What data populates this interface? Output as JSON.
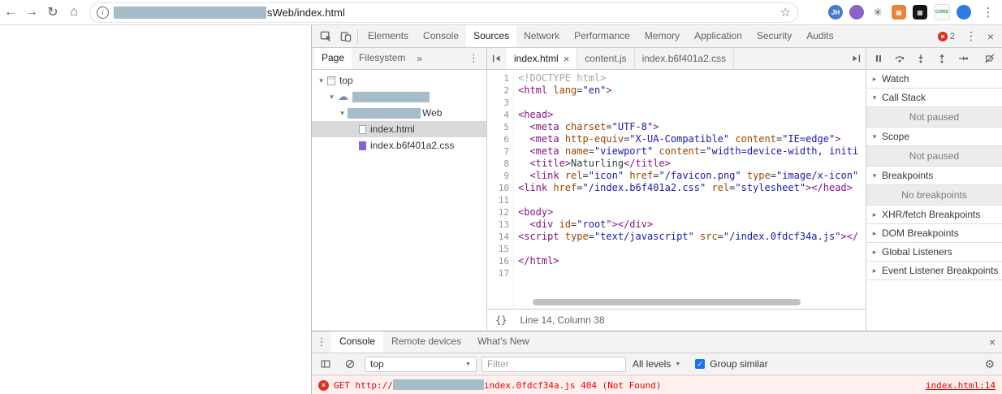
{
  "browser": {
    "url_suffix": "sWeb/index.html",
    "extensions": [
      {
        "id": "jh",
        "shape": "circle",
        "bg": "#4a7bc8",
        "fg": "#ffffff",
        "text": "JH"
      },
      {
        "id": "purple",
        "shape": "circle",
        "bg": "#8a64c9",
        "fg": "#ffffff",
        "text": ""
      },
      {
        "id": "asterisk",
        "shape": "none",
        "bg": "",
        "fg": "#5f6368",
        "text": "✳"
      },
      {
        "id": "orange",
        "shape": "square",
        "bg": "#e8833a",
        "fg": "#ffffff",
        "text": "▦"
      },
      {
        "id": "qr",
        "shape": "square",
        "bg": "#151515",
        "fg": "#ffffff",
        "text": "▦"
      },
      {
        "id": "cors",
        "shape": "square",
        "bg": "#fafafa",
        "fg": "#2a9d4a",
        "text": "CORS"
      },
      {
        "id": "blue",
        "shape": "circle",
        "bg": "#2f7de1",
        "fg": "#ffffff",
        "text": ""
      }
    ]
  },
  "devtools": {
    "main_tabs": [
      "Elements",
      "Console",
      "Sources",
      "Network",
      "Performance",
      "Memory",
      "Application",
      "Security",
      "Audits"
    ],
    "active_main_tab": "Sources",
    "error_badge_count": "2",
    "navigator": {
      "tabs": [
        "Page",
        "Filesystem"
      ],
      "active_tab": "Page",
      "overflow_icon": "»",
      "tree": [
        {
          "depth": 0,
          "arrow": "expanded",
          "icon": "frame",
          "label": "top",
          "redacted": false,
          "redact_width": 0,
          "selected": false
        },
        {
          "depth": 1,
          "arrow": "expanded",
          "icon": "cloud",
          "label": "",
          "redacted": true,
          "redact_width": 95,
          "selected": false
        },
        {
          "depth": 2,
          "arrow": "expanded",
          "icon": "none",
          "label": "Web",
          "redacted": true,
          "redact_width": 90,
          "selected": false
        },
        {
          "depth": 3,
          "arrow": "none",
          "icon": "file-html",
          "label": "index.html",
          "redacted": false,
          "redact_width": 0,
          "selected": true
        },
        {
          "depth": 3,
          "arrow": "none",
          "icon": "file-css",
          "label": "index.b6f401a2.css",
          "redacted": false,
          "redact_width": 0,
          "selected": false
        }
      ]
    },
    "editor": {
      "tabs": [
        {
          "label": "index.html",
          "active": true,
          "closable": true
        },
        {
          "label": "content.js",
          "active": false,
          "closable": false
        },
        {
          "label": "index.b6f401a2.css",
          "active": false,
          "closable": false
        }
      ],
      "pretty_print_label": "{}",
      "status_text": "Line 14, Column 38",
      "code_lines": [
        [
          [
            "m",
            "<!DOCTYPE html>"
          ]
        ],
        [
          [
            "t",
            "<html "
          ],
          [
            "a",
            "lang"
          ],
          [
            "p",
            "="
          ],
          [
            "v",
            "\"en\""
          ],
          [
            "t",
            ">"
          ]
        ],
        [],
        [
          [
            "t",
            "<head>"
          ]
        ],
        [
          [
            "p",
            "  "
          ],
          [
            "t",
            "<meta "
          ],
          [
            "a",
            "charset"
          ],
          [
            "p",
            "="
          ],
          [
            "v",
            "\"UTF-8\""
          ],
          [
            "t",
            ">"
          ]
        ],
        [
          [
            "p",
            "  "
          ],
          [
            "t",
            "<meta "
          ],
          [
            "a",
            "http-equiv"
          ],
          [
            "p",
            "="
          ],
          [
            "v",
            "\"X-UA-Compatible\""
          ],
          [
            "p",
            " "
          ],
          [
            "a",
            "content"
          ],
          [
            "p",
            "="
          ],
          [
            "v",
            "\"IE=edge\""
          ],
          [
            "t",
            ">"
          ]
        ],
        [
          [
            "p",
            "  "
          ],
          [
            "t",
            "<meta "
          ],
          [
            "a",
            "name"
          ],
          [
            "p",
            "="
          ],
          [
            "v",
            "\"viewport\""
          ],
          [
            "p",
            " "
          ],
          [
            "a",
            "content"
          ],
          [
            "p",
            "="
          ],
          [
            "v",
            "\"width=device-width, initi"
          ]
        ],
        [
          [
            "p",
            "  "
          ],
          [
            "t",
            "<title>"
          ],
          [
            "p",
            "Naturling"
          ],
          [
            "t",
            "</title>"
          ]
        ],
        [
          [
            "p",
            "  "
          ],
          [
            "t",
            "<link "
          ],
          [
            "a",
            "rel"
          ],
          [
            "p",
            "="
          ],
          [
            "v",
            "\"icon\""
          ],
          [
            "p",
            " "
          ],
          [
            "a",
            "href"
          ],
          [
            "p",
            "="
          ],
          [
            "v",
            "\"/favicon.png\""
          ],
          [
            "p",
            " "
          ],
          [
            "a",
            "type"
          ],
          [
            "p",
            "="
          ],
          [
            "v",
            "\"image/x-icon\""
          ]
        ],
        [
          [
            "t",
            "<link "
          ],
          [
            "a",
            "href"
          ],
          [
            "p",
            "="
          ],
          [
            "v",
            "\"/index.b6f401a2.css\""
          ],
          [
            "p",
            " "
          ],
          [
            "a",
            "rel"
          ],
          [
            "p",
            "="
          ],
          [
            "v",
            "\"stylesheet\""
          ],
          [
            "t",
            "></head>"
          ]
        ],
        [],
        [
          [
            "t",
            "<body>"
          ]
        ],
        [
          [
            "p",
            "  "
          ],
          [
            "t",
            "<div "
          ],
          [
            "a",
            "id"
          ],
          [
            "p",
            "="
          ],
          [
            "v",
            "\"root\""
          ],
          [
            "t",
            "></div>"
          ]
        ],
        [
          [
            "t",
            "<script "
          ],
          [
            "a",
            "type"
          ],
          [
            "p",
            "="
          ],
          [
            "v",
            "\"text/javascript\""
          ],
          [
            "p",
            " "
          ],
          [
            "a",
            "src"
          ],
          [
            "p",
            "="
          ],
          [
            "v",
            "\"/index.0fdcf34a.js\""
          ],
          [
            "t",
            "></"
          ]
        ],
        [],
        [
          [
            "t",
            "</html>"
          ]
        ],
        []
      ]
    },
    "debugger": {
      "sections": [
        {
          "label": "Watch",
          "arrow": "collapsed",
          "info": ""
        },
        {
          "label": "Call Stack",
          "arrow": "expanded",
          "info": "Not paused"
        },
        {
          "label": "Scope",
          "arrow": "expanded",
          "info": "Not paused"
        },
        {
          "label": "Breakpoints",
          "arrow": "expanded",
          "info": "No breakpoints"
        },
        {
          "label": "XHR/fetch Breakpoints",
          "arrow": "collapsed",
          "info": ""
        },
        {
          "label": "DOM Breakpoints",
          "arrow": "collapsed",
          "info": ""
        },
        {
          "label": "Global Listeners",
          "arrow": "collapsed",
          "info": ""
        },
        {
          "label": "Event Listener Breakpoints",
          "arrow": "collapsed",
          "info": ""
        }
      ]
    }
  },
  "console": {
    "tabs": [
      "Console",
      "Remote devices",
      "What's New"
    ],
    "active_tab": "Console",
    "context": "top",
    "filter_placeholder": "Filter",
    "levels_label": "All levels",
    "group_similar_label": "Group similar",
    "group_similar_checked": true,
    "error": {
      "prefix": "GET ",
      "scheme": "http://",
      "redacted": true,
      "file": "index.0fdcf34a.js",
      "status": " 404 (Not Found)",
      "link": "index.html:14"
    }
  },
  "colors": {
    "accent_blue": "#1a73e8",
    "error_red": "#e60000",
    "error_icon": "#d93025",
    "error_bg": "#fff0f0",
    "redaction": "#a5bdc9",
    "syntax_tag": "#881280",
    "syntax_attr": "#994500",
    "syntax_string": "#1a1aa6",
    "syntax_meta": "#a5a5a5",
    "toolbar_bg": "#f3f3f3",
    "selected_row": "#d9d9d9"
  }
}
